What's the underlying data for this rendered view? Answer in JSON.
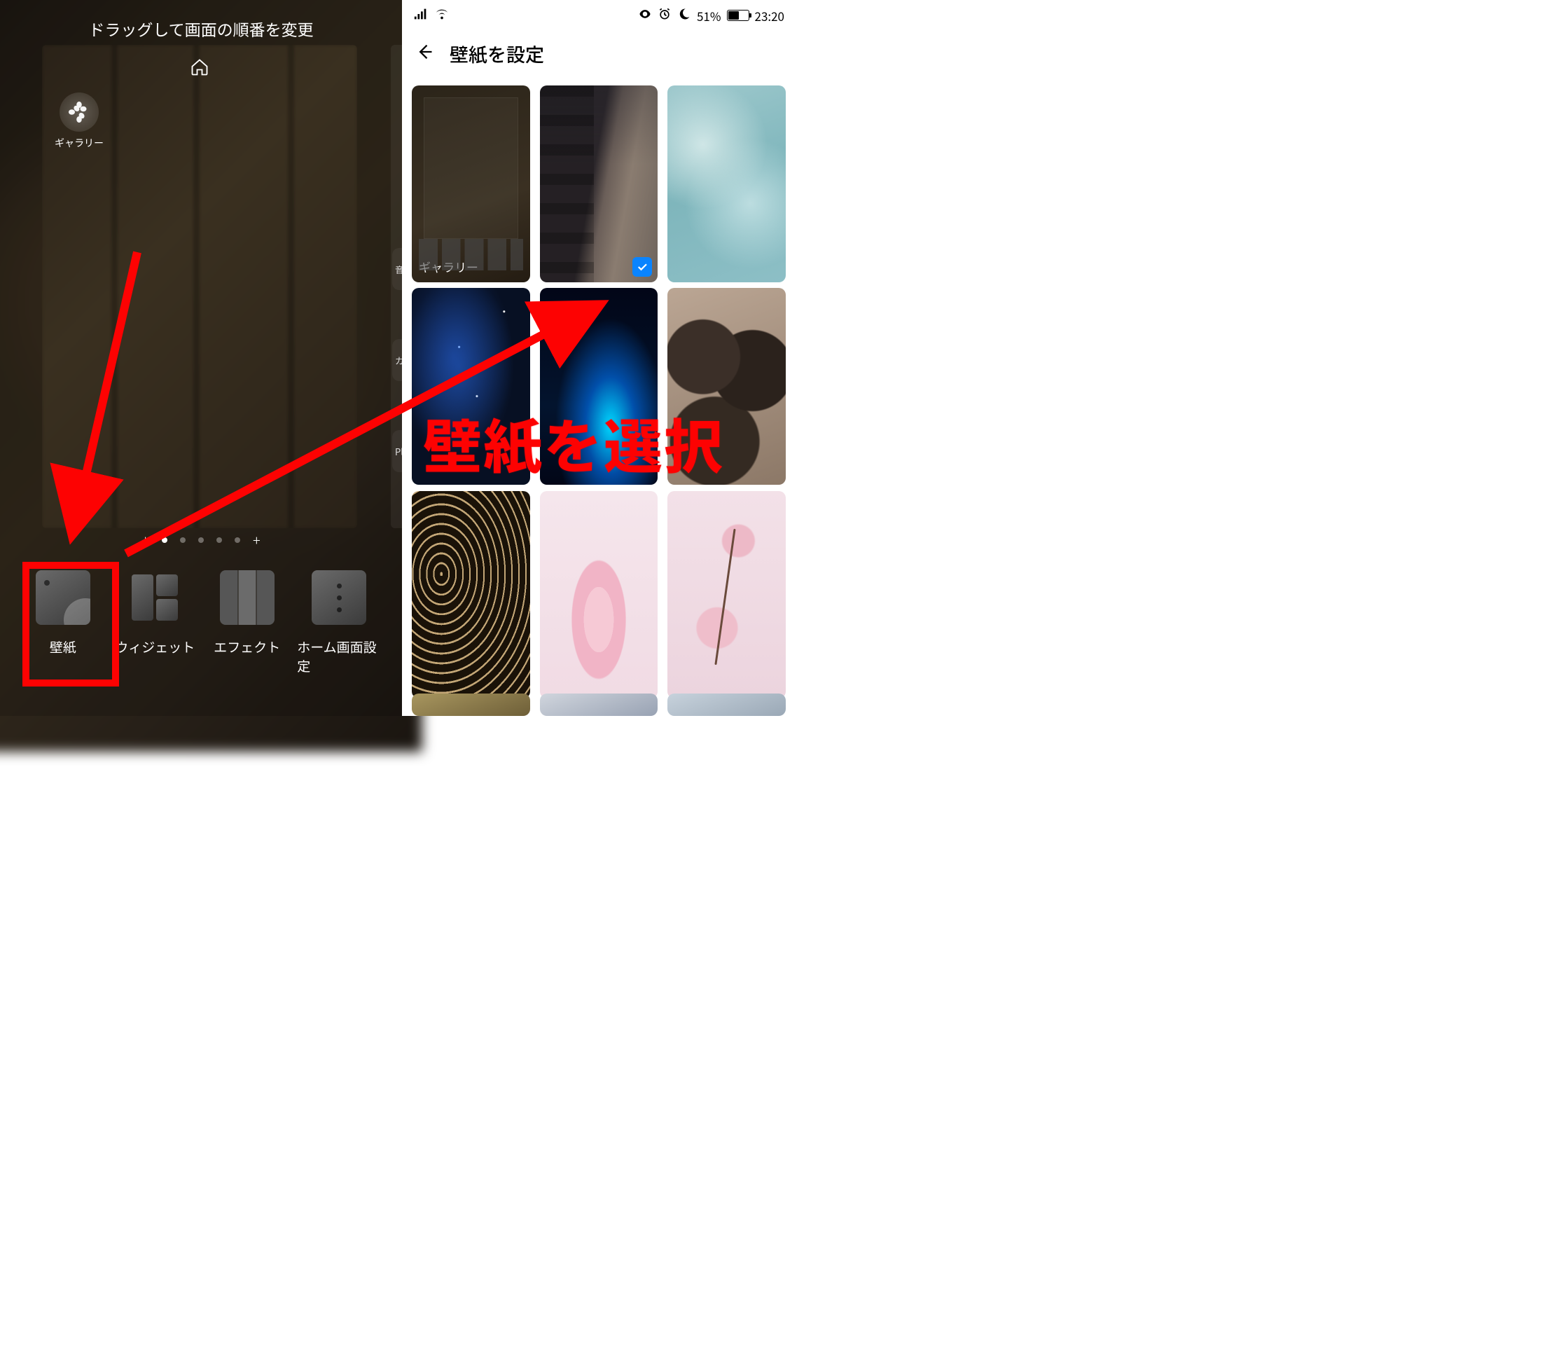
{
  "left": {
    "drag_title": "ドラッグして画面の順番を変更",
    "gallery_label": "ギャラリー",
    "peek_labels": [
      "音",
      "カ",
      "Pl"
    ],
    "page_indicator": {
      "total": 5,
      "active_index": 0
    },
    "toolbar": {
      "wallpaper": "壁紙",
      "widget": "ウィジェット",
      "effect": "エフェクト",
      "home_settings": "ホーム画面設定"
    }
  },
  "status": {
    "battery_percent": "51%",
    "time": "23:20"
  },
  "header": {
    "title": "壁紙を設定"
  },
  "wallpapers": {
    "gallery_label": "ギャラリー",
    "selected_index": 1
  },
  "annotation": {
    "text": "壁紙を選択"
  },
  "colors": {
    "annotation_red": "#fd0202",
    "check_blue": "#0a84ff"
  }
}
